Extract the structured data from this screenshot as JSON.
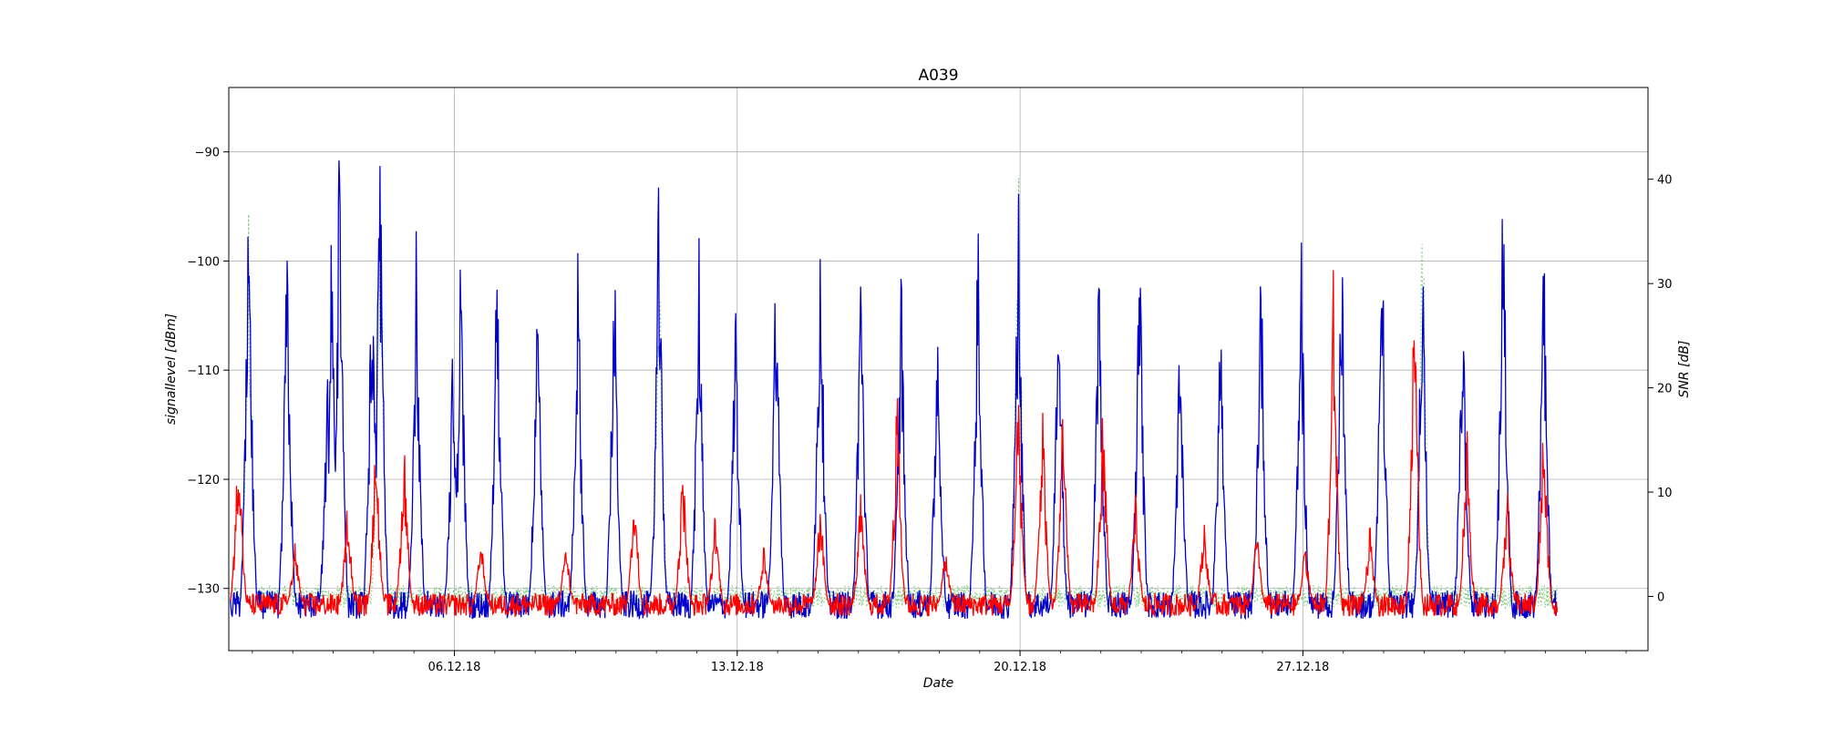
{
  "chart_data": {
    "type": "line",
    "title": "A039",
    "xlabel": "Date",
    "ylabel": "signallevel [dBm]",
    "y2label": "SNR [dB]",
    "x_range": [
      "2018-11-30T10:00",
      "2019-01-04T13:00"
    ],
    "x_ticks": [
      {
        "date": "2018-12-06",
        "label": "06.12.18"
      },
      {
        "date": "2018-12-13",
        "label": "13.12.18"
      },
      {
        "date": "2018-12-20",
        "label": "20.12.18"
      },
      {
        "date": "2018-12-27",
        "label": "27.12.18"
      }
    ],
    "y_range": [
      -135.7,
      -84.1
    ],
    "y_ticks": [
      -130,
      -120,
      -110,
      -100,
      -90
    ],
    "y2_range": [
      -5.2,
      48.8
    ],
    "y2_ticks": [
      0,
      10,
      20,
      30,
      40
    ],
    "data_range": [
      "2018-11-30T11:00",
      "2019-01-02T07:00"
    ],
    "grid": true,
    "series": [
      {
        "color": "#0000cc",
        "axis": "left",
        "style": "solid",
        "baseline": -131.5,
        "peaks": [
          {
            "day": 0.45,
            "value": -93
          },
          {
            "day": 1.4,
            "value": -96
          },
          {
            "day": 2.4,
            "value": -110
          },
          {
            "day": 2.5,
            "value": -96
          },
          {
            "day": 2.7,
            "value": -85.5
          },
          {
            "day": 3.5,
            "value": -96
          },
          {
            "day": 3.7,
            "value": -86.5
          },
          {
            "day": 4.6,
            "value": -96
          },
          {
            "day": 5.5,
            "value": -107
          },
          {
            "day": 5.7,
            "value": -96
          },
          {
            "day": 6.6,
            "value": -96
          },
          {
            "day": 7.6,
            "value": -96
          },
          {
            "day": 8.6,
            "value": -97
          },
          {
            "day": 9.5,
            "value": -97
          },
          {
            "day": 10.6,
            "value": -91
          },
          {
            "day": 11.6,
            "value": -96
          },
          {
            "day": 12.5,
            "value": -101
          },
          {
            "day": 13.5,
            "value": -96
          },
          {
            "day": 14.6,
            "value": -94
          },
          {
            "day": 15.6,
            "value": -96
          },
          {
            "day": 16.6,
            "value": -99
          },
          {
            "day": 17.5,
            "value": -103
          },
          {
            "day": 18.5,
            "value": -95
          },
          {
            "day": 19.5,
            "value": -90.5
          },
          {
            "day": 20.5,
            "value": -97
          },
          {
            "day": 21.5,
            "value": -95
          },
          {
            "day": 22.5,
            "value": -95
          },
          {
            "day": 23.5,
            "value": -105
          },
          {
            "day": 24.5,
            "value": -102
          },
          {
            "day": 25.5,
            "value": -96
          },
          {
            "day": 26.5,
            "value": -95
          },
          {
            "day": 27.5,
            "value": -96
          },
          {
            "day": 28.5,
            "value": -94
          },
          {
            "day": 29.5,
            "value": -95
          },
          {
            "day": 30.5,
            "value": -100
          },
          {
            "day": 31.5,
            "value": -88
          },
          {
            "day": 32.5,
            "value": -96
          }
        ]
      },
      {
        "color": "#ff0000",
        "axis": "right",
        "style": "solid",
        "baseline": -0.8,
        "peaks": [
          {
            "day": 0.2,
            "value": 17.5
          },
          {
            "day": 1.6,
            "value": 5.5
          },
          {
            "day": 2.9,
            "value": 10
          },
          {
            "day": 3.6,
            "value": 17
          },
          {
            "day": 4.3,
            "value": 16
          },
          {
            "day": 6.2,
            "value": 6
          },
          {
            "day": 8.3,
            "value": 6
          },
          {
            "day": 10.0,
            "value": 11
          },
          {
            "day": 11.2,
            "value": 14
          },
          {
            "day": 12.0,
            "value": 9
          },
          {
            "day": 13.2,
            "value": 5.5
          },
          {
            "day": 14.6,
            "value": 10
          },
          {
            "day": 15.6,
            "value": 10.5
          },
          {
            "day": 16.5,
            "value": 21
          },
          {
            "day": 17.7,
            "value": 5
          },
          {
            "day": 19.5,
            "value": 22.5
          },
          {
            "day": 20.1,
            "value": 19.5
          },
          {
            "day": 20.6,
            "value": 20
          },
          {
            "day": 21.6,
            "value": 20.5
          },
          {
            "day": 22.4,
            "value": 10
          },
          {
            "day": 24.1,
            "value": 8
          },
          {
            "day": 25.4,
            "value": 7
          },
          {
            "day": 26.6,
            "value": 5.5
          },
          {
            "day": 27.3,
            "value": 32.5
          },
          {
            "day": 28.2,
            "value": 7
          },
          {
            "day": 29.3,
            "value": 32.5
          },
          {
            "day": 30.6,
            "value": 18
          },
          {
            "day": 31.6,
            "value": 11
          },
          {
            "day": 32.5,
            "value": 18.5
          }
        ]
      },
      {
        "color": "#7fcc7f",
        "axis": "right",
        "style": "dotted",
        "baseline": 0,
        "peaks": [
          {
            "day": 0.45,
            "value": 40
          },
          {
            "day": 3.7,
            "value": 45.5
          },
          {
            "day": 10.6,
            "value": 43
          },
          {
            "day": 19.5,
            "value": 42
          },
          {
            "day": 29.5,
            "value": 41.5
          }
        ]
      }
    ]
  }
}
